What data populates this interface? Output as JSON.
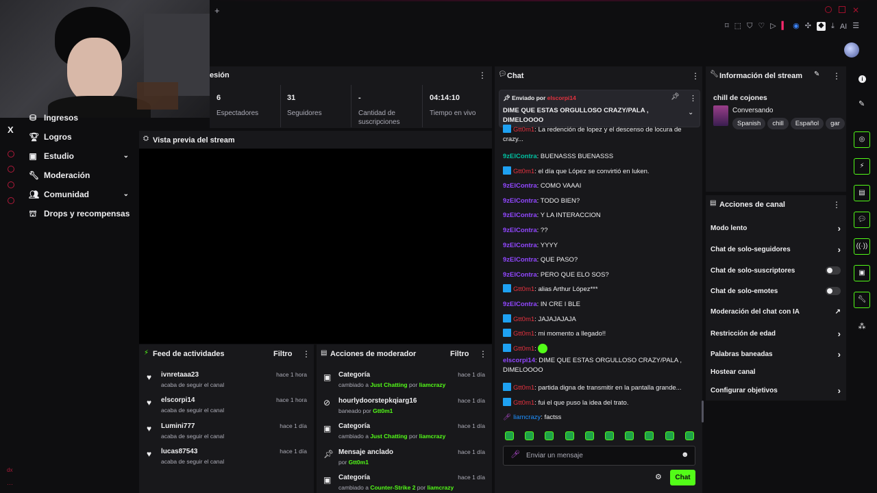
{
  "colors": {
    "accent": "#53fc18",
    "brand_purple": "#9147ff",
    "badge_blue": "#1ea1f2",
    "alert_red": "#eb0400"
  },
  "browser": {
    "new_tab_label": "+",
    "ai_label": "AI"
  },
  "sidebar": {
    "x_label": "X",
    "bottom_label": "dx",
    "items": [
      {
        "label": "Ingresos",
        "icon": "coins-icon"
      },
      {
        "label": "Logros",
        "icon": "trophy-icon"
      },
      {
        "label": "Estudio",
        "icon": "camera-icon",
        "expand": true
      },
      {
        "label": "Moderación",
        "icon": "wrench-icon"
      },
      {
        "label": "Comunidad",
        "icon": "people-icon",
        "expand": true
      },
      {
        "label": "Drops y recompensas",
        "icon": "gift-icon"
      }
    ]
  },
  "session": {
    "title_partial": "esión",
    "stats": [
      {
        "value": "6",
        "label": "Espectadores"
      },
      {
        "value": "31",
        "label": "Seguidores"
      },
      {
        "value": "-",
        "label": "Cantidad de suscripciones"
      },
      {
        "value": "04:14:10",
        "label": "Tiempo en vivo"
      }
    ]
  },
  "preview": {
    "title": "Vista previa del stream"
  },
  "activity": {
    "title": "Feed de actividades",
    "filter": "Filtro",
    "items": [
      {
        "name": "ivnretaaa23",
        "sub": "acaba de seguir el canal",
        "time": "hace 1 hora"
      },
      {
        "name": "elscorpi14",
        "sub": "acaba de seguir el canal",
        "time": "hace 1 hora"
      },
      {
        "name": "Lumini777",
        "sub": "acaba de seguir el canal",
        "time": "hace 1 día"
      },
      {
        "name": "lucas87543",
        "sub": "acaba de seguir el canal",
        "time": "hace 1 día"
      }
    ]
  },
  "modactions": {
    "title": "Acciones de moderador",
    "filter": "Filtro",
    "items": [
      {
        "title": "Categoría",
        "pre": "cambiado a ",
        "hl": "Just Chatting",
        "mid": " por ",
        "by": "liamcrazy",
        "time": "hace 1 día"
      },
      {
        "title": "hourlydoorstepkqiarg16",
        "pre": "baneado por ",
        "hl": "",
        "mid": "",
        "by": "Gtt0m1",
        "time": "hace 1 día"
      },
      {
        "title": "Categoría",
        "pre": "cambiado a ",
        "hl": "Just Chatting",
        "mid": " por ",
        "by": "liamcrazy",
        "time": "hace 1 día"
      },
      {
        "title": "Mensaje anclado",
        "pre": "por ",
        "hl": "",
        "mid": "",
        "by": "Gtt0m1",
        "time": "hace 1 día"
      },
      {
        "title": "Categoría",
        "pre": "cambiado a ",
        "hl": "Counter-Strike 2",
        "mid": " por ",
        "by": "liamcrazy",
        "time": "hace 1 día"
      }
    ]
  },
  "chat": {
    "title": "Chat",
    "pinned": {
      "prefix": "Enviado por",
      "user": "elscorpi14",
      "text": "DIME QUE ESTAS ORGULLOSO CRAZY/PALA , DIMELOOOO"
    },
    "messages": [
      {
        "user": "Gtt0m1",
        "style": "r",
        "badge": true,
        "text": "La redención de lopez y el descenso de locura de crazy..."
      },
      {
        "user": "9zElContra",
        "style": "g",
        "badge": false,
        "text": "BUENASSS BUENASSS"
      },
      {
        "user": "Gtt0m1",
        "style": "r",
        "badge": true,
        "text": "el día que López se convirtió en luken."
      },
      {
        "user": "9zElContra",
        "style": "p",
        "badge": false,
        "text": "COMO VAAAI"
      },
      {
        "user": "9zElContra",
        "style": "p",
        "badge": false,
        "text": "TODO BIEN?"
      },
      {
        "user": "9zElContra",
        "style": "p",
        "badge": false,
        "text": "Y LA INTERACCION"
      },
      {
        "user": "9zElContra",
        "style": "p",
        "badge": false,
        "text": "??"
      },
      {
        "user": "9zElContra",
        "style": "p",
        "badge": false,
        "text": "YYYY"
      },
      {
        "user": "9zElContra",
        "style": "p",
        "badge": false,
        "text": "QUE PASO?"
      },
      {
        "user": "9zElContra",
        "style": "p",
        "badge": false,
        "text": "PERO QUE ELO SOS?"
      },
      {
        "user": "Gtt0m1",
        "style": "r",
        "badge": true,
        "text": "alias Arthur López***"
      },
      {
        "user": "9zElContra",
        "style": "p",
        "badge": false,
        "text": "IN CRE I BLE"
      },
      {
        "user": "Gtt0m1",
        "style": "r",
        "badge": true,
        "text": "JAJAJAJAJA"
      },
      {
        "user": "Gtt0m1",
        "style": "r",
        "badge": true,
        "text": "mi momento a llegado!!"
      },
      {
        "user": "Gtt0m1",
        "style": "r",
        "badge": true,
        "text": ""
      },
      {
        "user": "elscorpi14",
        "style": "p",
        "badge": false,
        "text": "DIME QUE ESTAS ORGULLOSO CRAZY/PALA , DIMELOOOO"
      },
      {
        "user": "Gtt0m1",
        "style": "r",
        "badge": true,
        "text": "partida digna de transmitir en la pantalla grande..."
      },
      {
        "user": "Gtt0m1",
        "style": "r",
        "badge": true,
        "text": "fui el que puso la idea del trato."
      },
      {
        "user": "liamcrazy",
        "style": "b",
        "badge": false,
        "text": "factss"
      }
    ],
    "input_placeholder": "Enviar un mensaje",
    "send_label": "Chat"
  },
  "streaminfo": {
    "title": "Información del stream",
    "stream_title": "chill de cojones",
    "category": "Conversando",
    "tags": [
      "Spanish",
      "chill",
      "Español",
      "gar"
    ]
  },
  "channel_actions": {
    "title": "Acciones de canal",
    "items": [
      {
        "label": "Modo lento",
        "control": "chevron"
      },
      {
        "label": "Chat de solo-seguidores",
        "control": "chevron"
      },
      {
        "label": "Chat de solo-suscriptores",
        "control": "toggle"
      },
      {
        "label": "Chat de solo-emotes",
        "control": "toggle"
      },
      {
        "label": "Moderación del chat con IA",
        "control": "external"
      },
      {
        "label": "Restricción de edad",
        "control": "chevron"
      },
      {
        "label": "Palabras baneadas",
        "control": "chevron"
      },
      {
        "label": "Hostear canal",
        "control": "none"
      },
      {
        "label": "Configurar objetivos",
        "control": "chevron"
      }
    ]
  }
}
